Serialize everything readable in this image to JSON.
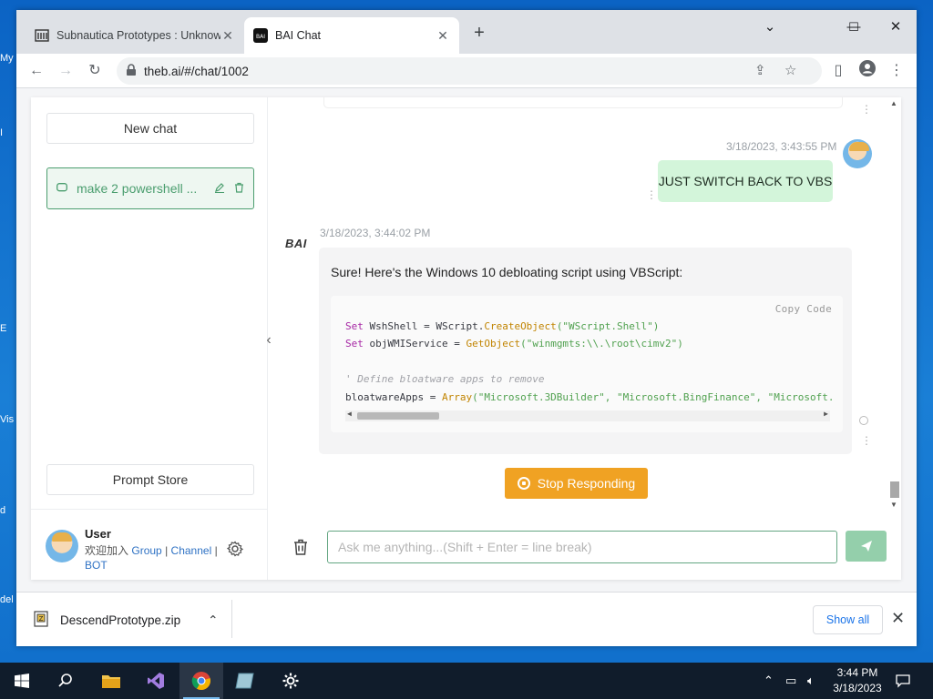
{
  "desktop": {
    "labels": [
      "My",
      "I",
      "E",
      "Vis",
      "d",
      "del"
    ]
  },
  "browser": {
    "tabs": [
      {
        "title": "Subnautica Prototypes : Unknow",
        "active": false
      },
      {
        "title": "BAI Chat",
        "active": true
      }
    ],
    "url": "theb.ai/#/chat/1002"
  },
  "sidebar": {
    "new_chat": "New chat",
    "chats": [
      {
        "label": "make 2 powershell ..."
      }
    ],
    "prompt_store": "Prompt Store",
    "user": {
      "name": "User",
      "prefix": "欢迎加入",
      "links": [
        "Group",
        "Channel",
        "BOT"
      ],
      "sep": "|"
    }
  },
  "chat": {
    "user_msg": {
      "time": "3/18/2023, 3:43:55 PM",
      "text": "JUST SWITCH BACK TO VBS"
    },
    "bot_msg": {
      "logo": "BAI",
      "time": "3/18/2023, 3:44:02 PM",
      "intro": "Sure! Here's the Windows 10 debloating script using VBScript:",
      "copy_label": "Copy  Code",
      "code": {
        "line1_kw": "Set",
        "line1_rest": " WshShell = WScript.",
        "line1_fn": "CreateObject",
        "line1_str": "(\"WScript.Shell\")",
        "line2_kw": "Set",
        "line2_rest": " objWMIService = ",
        "line2_fn": "GetObject",
        "line2_str": "(\"winmgmts:\\\\.\\root\\cimv2\")",
        "line3_cm": "' Define bloatware apps to remove",
        "line4_rest": "bloatwareApps = ",
        "line4_fn": "Array",
        "line4_str": "(\"Microsoft.3DBuilder\", \"Microsoft.BingFinance\", \"Microsoft."
      }
    },
    "stop_button": "Stop Responding",
    "input_placeholder": "Ask me anything...(Shift + Enter = line break)"
  },
  "downloads": {
    "file": "DescendPrototype.zip",
    "show_all": "Show all"
  },
  "taskbar": {
    "time": "3:44 PM",
    "date": "3/18/2023"
  }
}
